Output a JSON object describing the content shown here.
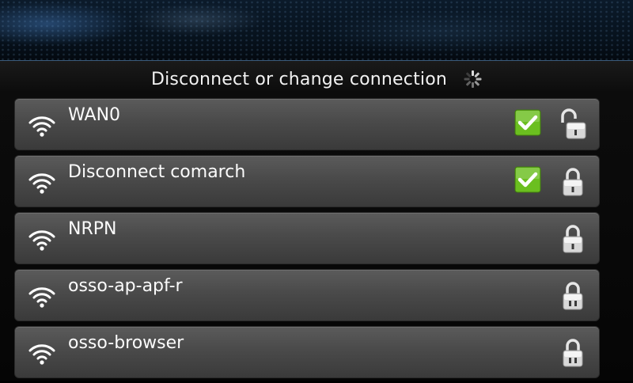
{
  "header": {
    "title": "Disconnect or change connection"
  },
  "networks": [
    {
      "name": "WAN0",
      "connected": true,
      "lock": "unlocked-padlock-icon"
    },
    {
      "name": "Disconnect comarch",
      "connected": true,
      "lock": "padlock-icon"
    },
    {
      "name": "NRPN",
      "connected": false,
      "lock": "padlock-icon"
    },
    {
      "name": "osso-ap-apf-r",
      "connected": false,
      "lock": "padlock-icon"
    },
    {
      "name": "osso-browser",
      "connected": false,
      "lock": "padlock-icon"
    }
  ],
  "colors": {
    "check_green": "#6bbf1f",
    "row_top": "#5b5b5b",
    "row_bottom": "#3a3a3a"
  }
}
